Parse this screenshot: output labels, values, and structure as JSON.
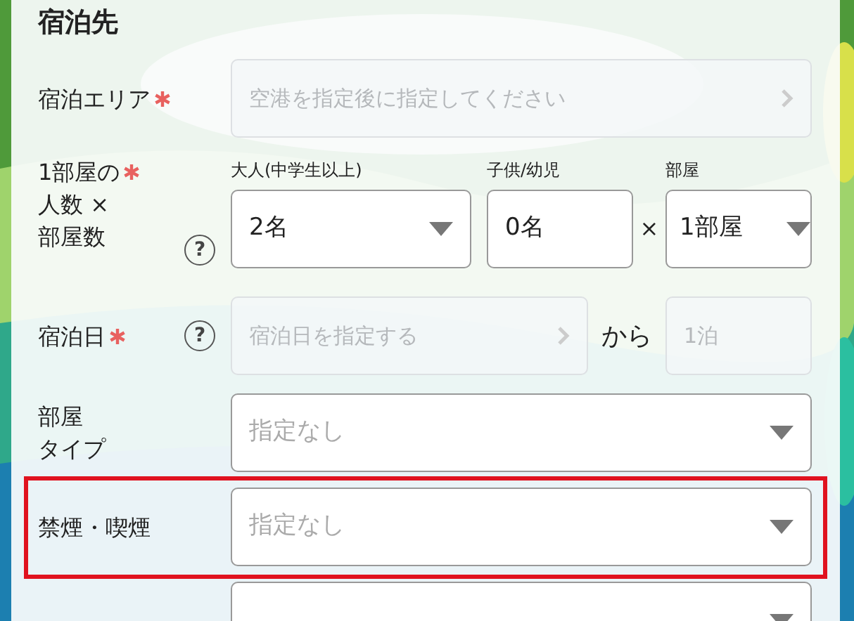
{
  "section_title": "宿泊先",
  "fields": [
    {
      "kind": "link",
      "label_lines": [
        "宿泊エリア"
      ],
      "required": true,
      "placeholder": "空港を指定後に指定してください",
      "disabled": true,
      "highlighted": false
    },
    {
      "kind": "guests",
      "label_lines": [
        "1部屋の",
        "人数 ×",
        "部屋数"
      ],
      "required": true,
      "help": "?",
      "highlighted": false,
      "separator": "×",
      "selects": [
        {
          "caption": "大人(中学生以上)",
          "value": "2名",
          "dropdown": true
        },
        {
          "caption": "子供/幼児",
          "value": "0名",
          "dropdown": false
        },
        {
          "caption": "部屋",
          "value": "1部屋",
          "dropdown": true
        }
      ]
    },
    {
      "kind": "date",
      "label_lines": [
        "宿泊日"
      ],
      "required": true,
      "help": "?",
      "placeholder": "宿泊日を指定する",
      "disabled": true,
      "connector": "から",
      "nights_placeholder": "1泊",
      "highlighted": false
    },
    {
      "kind": "select",
      "label_lines": [
        "部屋",
        "タイプ"
      ],
      "required": false,
      "placeholder": "指定なし",
      "highlighted": false
    },
    {
      "kind": "select",
      "label_lines": [
        "禁煙・喫煙"
      ],
      "required": false,
      "placeholder": "指定なし",
      "highlighted": true
    },
    {
      "kind": "select",
      "highlighted": false
    }
  ]
}
